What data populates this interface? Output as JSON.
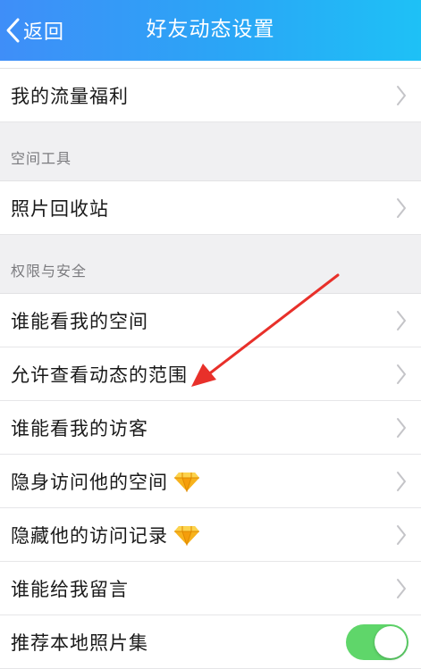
{
  "header": {
    "back_label": "返回",
    "title": "好友动态设置",
    "gradient_start": "#3f8ef8",
    "gradient_end": "#1ec1f6"
  },
  "rows_top": [
    {
      "label": "我的流量福利"
    }
  ],
  "section_tools": {
    "label": "空间工具",
    "items": [
      {
        "label": "照片回收站"
      }
    ]
  },
  "section_security": {
    "label": "权限与安全",
    "items": [
      {
        "label": "谁能看我的空间"
      },
      {
        "label": "允许查看动态的范围"
      },
      {
        "label": "谁能看我的访客"
      },
      {
        "label": "隐身访问他的空间",
        "icon": "diamond-icon"
      },
      {
        "label": "隐藏他的访问记录",
        "icon": "diamond-icon"
      },
      {
        "label": "谁能给我留言"
      },
      {
        "label": "推荐本地照片集",
        "toggle": "on"
      }
    ]
  },
  "colors": {
    "toggle_on": "#5fd66a",
    "annotation_arrow": "#e8302a"
  },
  "icons": {
    "back": "chevron-left-icon",
    "row_chevron": "chevron-right-icon",
    "vip": "diamond-icon"
  }
}
